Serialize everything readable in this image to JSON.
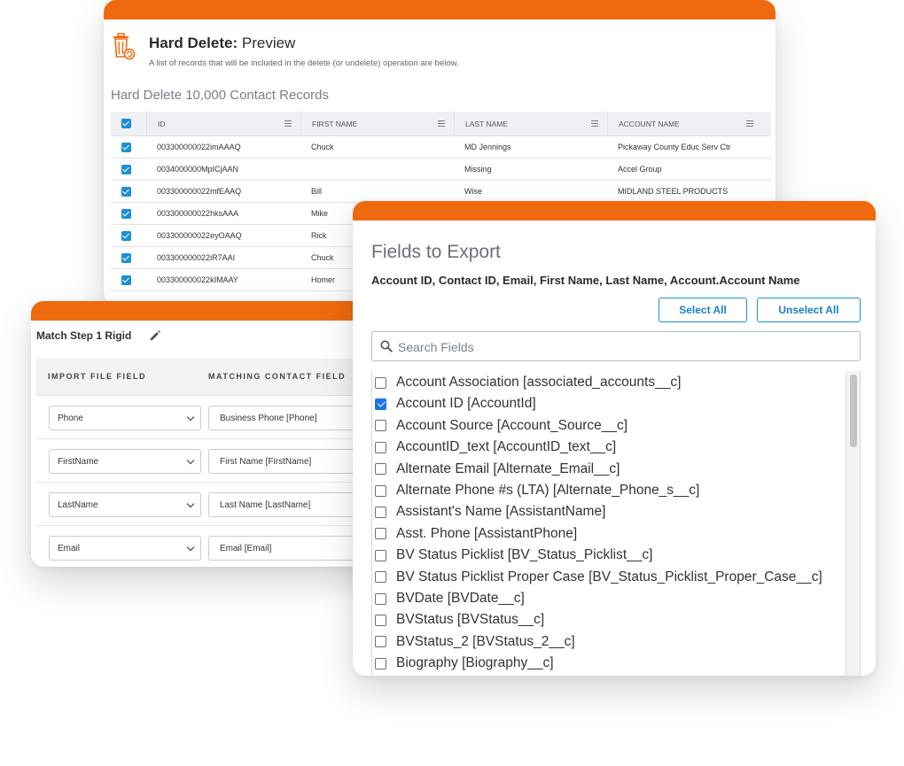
{
  "hard_delete": {
    "title_bold": "Hard Delete:",
    "title_rest": " Preview",
    "subtitle": "A list of records that will be included in the delete (or undelete) operation are below.",
    "section": "Hard Delete 10,000 Contact Records",
    "columns": [
      "ID",
      "FIRST NAME",
      "LAST NAME",
      "ACCOUNT NAME"
    ],
    "rows": [
      {
        "id": "003300000022imAAAQ",
        "first": "Chuck",
        "last": "MD Jennings",
        "account": "Pickaway County Educ Serv Ctr"
      },
      {
        "id": "0034000000MpICjAAN",
        "first": "",
        "last": "Missing",
        "account": "Accel Group"
      },
      {
        "id": "003300000022mfEAAQ",
        "first": "Bill",
        "last": "Wise",
        "account": "MIDLAND STEEL PRODUCTS"
      },
      {
        "id": "003300000022hksAAA",
        "first": "Mike",
        "last": "",
        "account": ""
      },
      {
        "id": "003300000022eyOAAQ",
        "first": "Rick",
        "last": "",
        "account": ""
      },
      {
        "id": "003300000022iR7AAI",
        "first": "Chuck",
        "last": "",
        "account": ""
      },
      {
        "id": "003300000022kIMAAY",
        "first": "Homer",
        "last": "",
        "account": ""
      }
    ]
  },
  "match_step": {
    "title": "Match Step 1 Rigid",
    "col_import": "IMPORT FILE FIELD",
    "col_matching": "MATCHING CONTACT FIELD",
    "rows": [
      {
        "import": "Phone",
        "matching": "Business Phone [Phone]"
      },
      {
        "import": "FirstName",
        "matching": "First Name [FirstName]"
      },
      {
        "import": "LastName",
        "matching": "Last Name [LastName]"
      },
      {
        "import": "Email",
        "matching": "Email [Email]"
      }
    ]
  },
  "export": {
    "title": "Fields to Export",
    "selected": "Account ID, Contact ID, Email, First Name, Last Name, Account.Account Name",
    "select_all": "Select All",
    "unselect_all": "Unselect All",
    "search_placeholder": "Search Fields",
    "fields": [
      {
        "label": "Account Association [associated_accounts__c]",
        "checked": false
      },
      {
        "label": "Account ID [AccountId]",
        "checked": true
      },
      {
        "label": "Account Source [Account_Source__c]",
        "checked": false
      },
      {
        "label": "AccountID_text [AccountID_text__c]",
        "checked": false
      },
      {
        "label": "Alternate Email [Alternate_Email__c]",
        "checked": false
      },
      {
        "label": "Alternate Phone #s (LTA) [Alternate_Phone_s__c]",
        "checked": false
      },
      {
        "label": "Assistant's Name [AssistantName]",
        "checked": false
      },
      {
        "label": "Asst. Phone [AssistantPhone]",
        "checked": false
      },
      {
        "label": "BV Status Picklist [BV_Status_Picklist__c]",
        "checked": false
      },
      {
        "label": "BV Status Picklist Proper Case [BV_Status_Picklist_Proper_Case__c]",
        "checked": false
      },
      {
        "label": "BVDate [BVDate__c]",
        "checked": false
      },
      {
        "label": "BVStatus [BVStatus__c]",
        "checked": false
      },
      {
        "label": "BVStatus_2 [BVStatus_2__c]",
        "checked": false
      },
      {
        "label": "Biography [Biography__c]",
        "checked": false
      }
    ]
  },
  "colors": {
    "accent": "#ef6a0e",
    "link": "#1b8fd9",
    "checkbox": "#1a73e8"
  },
  "icons": [
    "trash-restore-icon",
    "pencil-icon",
    "search-icon",
    "menu-icon",
    "chevron-down-icon"
  ]
}
